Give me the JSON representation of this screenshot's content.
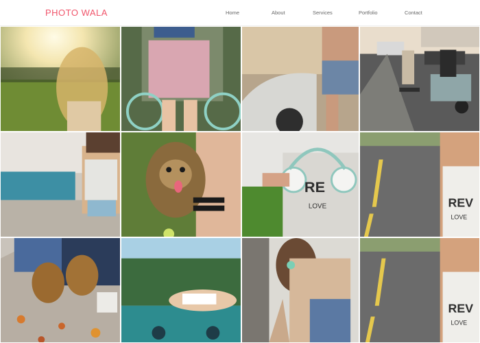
{
  "site": {
    "brand": "PHOTO WALA",
    "brand_color": "#f0546a"
  },
  "nav": {
    "items": [
      {
        "label": "Home"
      },
      {
        "label": "About"
      },
      {
        "label": "Services"
      },
      {
        "label": "Portfolio"
      },
      {
        "label": "Contact"
      }
    ]
  },
  "printed_text": {
    "shirt_text_1": "RE",
    "shirt_text_2": "LOVE",
    "shirt_text_3": "REV",
    "shirt_text_4": "LOVE",
    "shirt_text_5": "REV",
    "shirt_text_6": "LOVE"
  }
}
